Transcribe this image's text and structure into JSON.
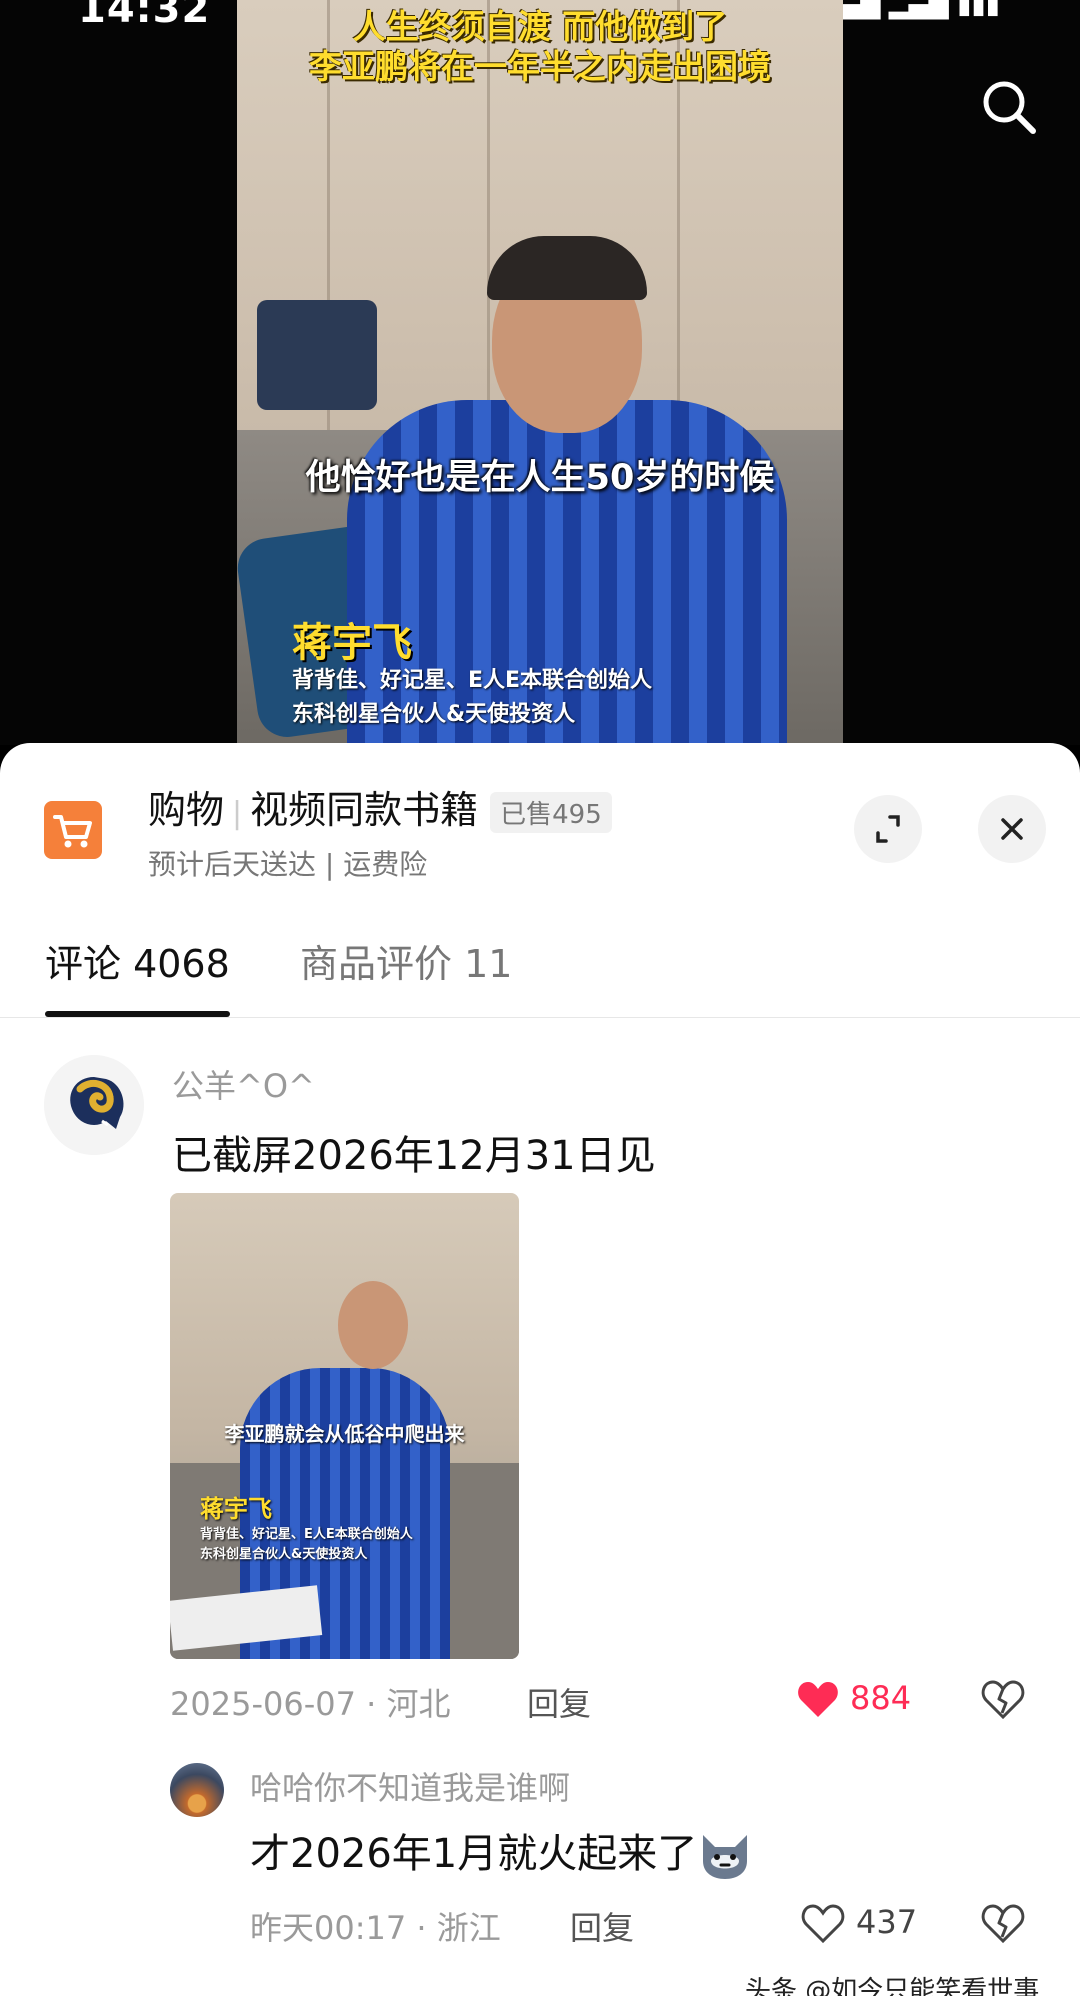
{
  "status": {
    "time": "14:32"
  },
  "video": {
    "caption_top_1": "人生终须自渡 而他做到了",
    "caption_top_2": "李亚鹏将在一年半之内走出困境",
    "caption_mid": "他恰好也是在人生50岁的时候",
    "speaker_name": "蒋宇飞",
    "speaker_title_1": "背背佳、好记星、E人E本联合创始人",
    "speaker_title_2": "东科创星合伙人&天使投资人"
  },
  "shop": {
    "category": "购物",
    "title": "视频同款书籍",
    "sold": "已售495",
    "subtitle": "预计后天送达 | 运费险"
  },
  "tabs": [
    {
      "label": "评论 4068"
    },
    {
      "label": "商品评价 11"
    }
  ],
  "comments": [
    {
      "user": "公羊^O^",
      "text": "已截屏2026年12月31日见",
      "image_caption": "李亚鹏就会从低谷中爬出来",
      "image_name": "蒋宇飞",
      "image_title_1": "背背佳、好记星、E人E本联合创始人",
      "image_title_2": "东科创星合伙人&天使投资人",
      "date": "2025-06-07",
      "location": "河北",
      "reply": "回复",
      "likes": "884",
      "liked": true
    },
    {
      "user": "哈哈你不知道我是谁啊",
      "text": "才2026年1月就火起来了",
      "date": "昨天00:17",
      "location": "浙江",
      "reply": "回复",
      "likes": "437",
      "liked": false
    }
  ],
  "watermark": "头条 @如今只能笑看世事",
  "colors": {
    "accent_red": "#fe2c55",
    "cart_orange": "#f5803a"
  },
  "icons": [
    "search-icon",
    "cart-icon",
    "expand-icon",
    "close-icon",
    "heart-icon",
    "dislike-icon"
  ]
}
